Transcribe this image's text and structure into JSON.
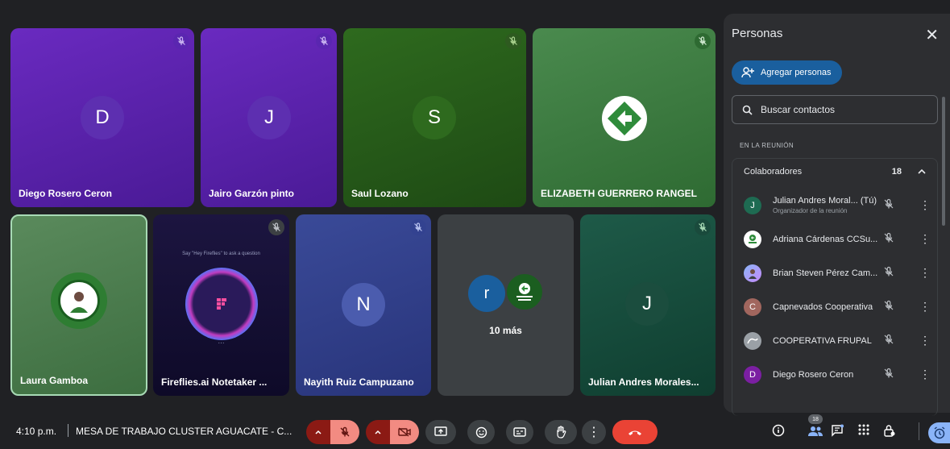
{
  "tiles": [
    {
      "name": "Diego Rosero Ceron",
      "initial": "D"
    },
    {
      "name": "Jairo Garzón pinto",
      "initial": "J"
    },
    {
      "name": "Saul Lozano",
      "initial": "S"
    },
    {
      "name": "ELIZABETH GUERRERO RANGEL"
    },
    {
      "name": "Laura Gamboa"
    },
    {
      "name": "Fireflies.ai Notetaker ...",
      "prompt": "Say \"Hey Fireflies\" to ask a question",
      "dots": "..."
    },
    {
      "name": "Nayith Ruiz Campuzano",
      "initial": "N"
    },
    {
      "initial": "r",
      "more_label": "10 más"
    },
    {
      "name": "Julian Andres Morales...",
      "initial": "J"
    }
  ],
  "panel": {
    "title": "Personas",
    "add_label": "Agregar personas",
    "search_placeholder": "Buscar contactos",
    "section": "EN LA REUNIÓN",
    "group_name": "Colaboradores",
    "group_count": "18",
    "people": [
      {
        "name": "Julian Andres Moral... (Tú)",
        "subtitle": "Organizador de la reunión",
        "initial": "J",
        "color": "#1e6b52"
      },
      {
        "name": "Adriana Cárdenas CCSu...",
        "initial": "",
        "color": "#ffffff"
      },
      {
        "name": "Brian Steven Pérez Cam...",
        "initial": "",
        "color": "#8ab4f8"
      },
      {
        "name": "Capnevados Cooperativa",
        "initial": "C",
        "color": "#a1665e"
      },
      {
        "name": "COOPERATIVA FRUPAL",
        "initial": "",
        "color": "#9aa0a6"
      },
      {
        "name": "Diego Rosero Ceron",
        "initial": "D",
        "color": "#7b1fa2"
      }
    ]
  },
  "bottom": {
    "time": "4:10 p.m.",
    "meeting": "MESA DE TRABAJO CLUSTER AGUACATE - C...",
    "people_count": "18"
  },
  "colors": {
    "accent_blue": "#1a5f9e",
    "end_call_red": "#ea4335",
    "muted_red": "#8b1a14",
    "active_border": "#a8dab5"
  }
}
